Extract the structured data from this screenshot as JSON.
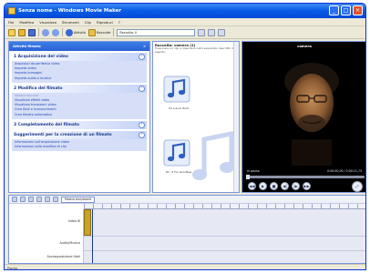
{
  "window": {
    "title": "Senza nome - Windows Movie Maker",
    "controls": [
      "_",
      "□",
      "×"
    ]
  },
  "menu": [
    "File",
    "Modifica",
    "Visualizza",
    "Strumenti",
    "Clip",
    "Riproduci",
    "?"
  ],
  "toolbar": {
    "tasks_label": "Attività",
    "collections_label": "Raccolte",
    "collection_value": "Raccolta: Il"
  },
  "tasks_panel": {
    "title": "Attività filmato",
    "groups": [
      {
        "number": "1",
        "title": "Acquisizione del video",
        "links": [
          "Acquisisci da periferica video",
          "Importa video",
          "Importa immagini",
          "Importa audio o musica"
        ]
      },
      {
        "number": "2",
        "title": "Modifica del filmato",
        "links": [
          "Mostra raccolte",
          "Visualizza effetti video",
          "Visualizza transizioni video",
          "Crea titoli o riconoscimenti",
          "Crea filmato automatico"
        ]
      },
      {
        "number": "3",
        "title": "Completamento del filmato",
        "links": []
      },
      {
        "number": "",
        "title": "Suggerimenti per la creazione di un filmato",
        "links": [
          "Informazioni sull'acquisizione video",
          "Informazioni sulla modifica di clip"
        ]
      }
    ]
  },
  "contents": {
    "title": "Raccolta: camera (2)",
    "subtitle": "Trascinare un clip e rilasciarlo nello sequenzio descritto di seguito.",
    "clips": [
      {
        "label": "01 Lunch Hold"
      },
      {
        "label": "02 - Il For Goodbye"
      }
    ]
  },
  "monitor": {
    "title": "camera",
    "status_left": "In pausa",
    "status_right": "0:00:00,00 / 0:00:11,73",
    "transport": [
      "◀◀",
      "▶",
      "■",
      "◀|",
      "|▶",
      "▶▶",
      "⤢"
    ]
  },
  "timeline": {
    "show_storyboard_label": "Mostra storyboard",
    "tracks": [
      {
        "label": "Video  ⊞"
      },
      {
        "label": "Audio/Musica"
      },
      {
        "label": "Sovrapposizione titoli"
      }
    ]
  },
  "statusbar": {
    "text": "Pronto"
  },
  "colors": {
    "title_bar": "#0a5ee8",
    "panel_border": "#7a96df",
    "link": "#2146b6",
    "clip": "#c9a227"
  }
}
